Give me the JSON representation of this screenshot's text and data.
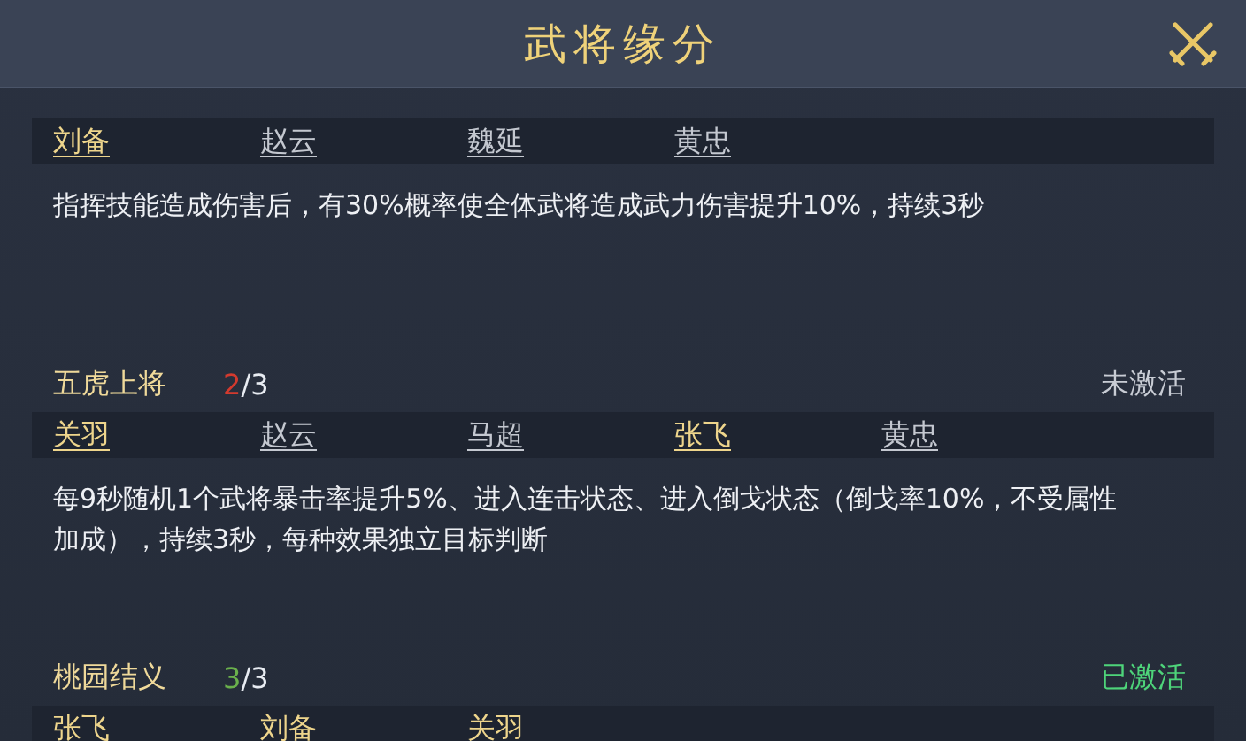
{
  "window": {
    "title": "武将缘分"
  },
  "groups": [
    {
      "members": [
        {
          "name": "刘备",
          "owned": true
        },
        {
          "name": "赵云",
          "owned": false
        },
        {
          "name": "魏延",
          "owned": false
        },
        {
          "name": "黄忠",
          "owned": false
        }
      ],
      "description": "指挥技能造成伤害后，有30%概率使全体武将造成武力伤害提升10%，持续3秒"
    },
    {
      "name": "五虎上将",
      "owned_count": "2",
      "total": "/3",
      "active": false,
      "status": "未激活",
      "members": [
        {
          "name": "关羽",
          "owned": true
        },
        {
          "name": "赵云",
          "owned": false
        },
        {
          "name": "马超",
          "owned": false
        },
        {
          "name": "张飞",
          "owned": true
        },
        {
          "name": "黄忠",
          "owned": false
        }
      ],
      "description": "每9秒随机1个武将暴击率提升5%、进入连击状态、进入倒戈状态（倒戈率10%，不受属性加成），持续3秒，每种效果独立目标判断"
    },
    {
      "name": "桃园结义",
      "owned_count": "3",
      "total": "/3",
      "active": true,
      "status": "已激活",
      "members": [
        {
          "name": "张飞",
          "owned": true
        },
        {
          "name": "刘备",
          "owned": true
        },
        {
          "name": "关羽",
          "owned": true
        }
      ]
    }
  ]
}
